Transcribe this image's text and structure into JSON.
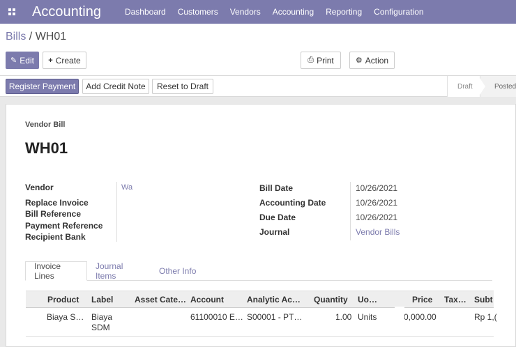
{
  "app": {
    "brand": "Accounting"
  },
  "nav": {
    "items": [
      "Dashboard",
      "Customers",
      "Vendors",
      "Accounting",
      "Reporting",
      "Configuration"
    ]
  },
  "breadcrumb": {
    "parent": "Bills",
    "separator": " / ",
    "current": "WH01"
  },
  "toolbar": {
    "edit": "Edit",
    "create": "Create",
    "print": "Print",
    "action": "Action"
  },
  "statusbar": {
    "register_payment": "Register Payment",
    "add_credit_note": "Add Credit Note",
    "reset_to_draft": "Reset to Draft",
    "stages": [
      "Draft",
      "Posted"
    ],
    "active_stage": "Posted"
  },
  "bill": {
    "type_label": "Vendor Bill",
    "name": "WH01",
    "left_fields": {
      "vendor_label": "Vendor",
      "vendor_value": "Wa",
      "replace_invoice_label": "Replace Invoice",
      "bill_reference_label": "Bill Reference",
      "payment_reference_label": "Payment Reference",
      "recipient_bank_label": "Recipient Bank"
    },
    "right_fields": {
      "bill_date_label": "Bill Date",
      "bill_date": "10/26/2021",
      "accounting_date_label": "Accounting Date",
      "accounting_date": "10/26/2021",
      "due_date_label": "Due Date",
      "due_date": "10/26/2021",
      "journal_label": "Journal",
      "journal": "Vendor Bills"
    }
  },
  "tabs": [
    "Invoice Lines",
    "Journal Items",
    "Other Info"
  ],
  "lines": {
    "columns": [
      "Product",
      "Label",
      "Asset Cate…",
      "Account",
      "Analytic Ac…",
      "Quantity",
      "Uo…",
      "Price",
      "Tax…",
      "Subt"
    ],
    "rows": [
      {
        "product": "Biaya S…",
        "label_line1": "Biaya",
        "label_line2": "SDM",
        "account": "61100010 E…",
        "analytic": "S00001 - PT…",
        "quantity": "1.00",
        "uom": "Units",
        "price": "0,000.00",
        "subtotal": "Rp 1,("
      }
    ]
  },
  "colors": {
    "brand": "#7c7bad",
    "navbar": "#7c7bad"
  }
}
